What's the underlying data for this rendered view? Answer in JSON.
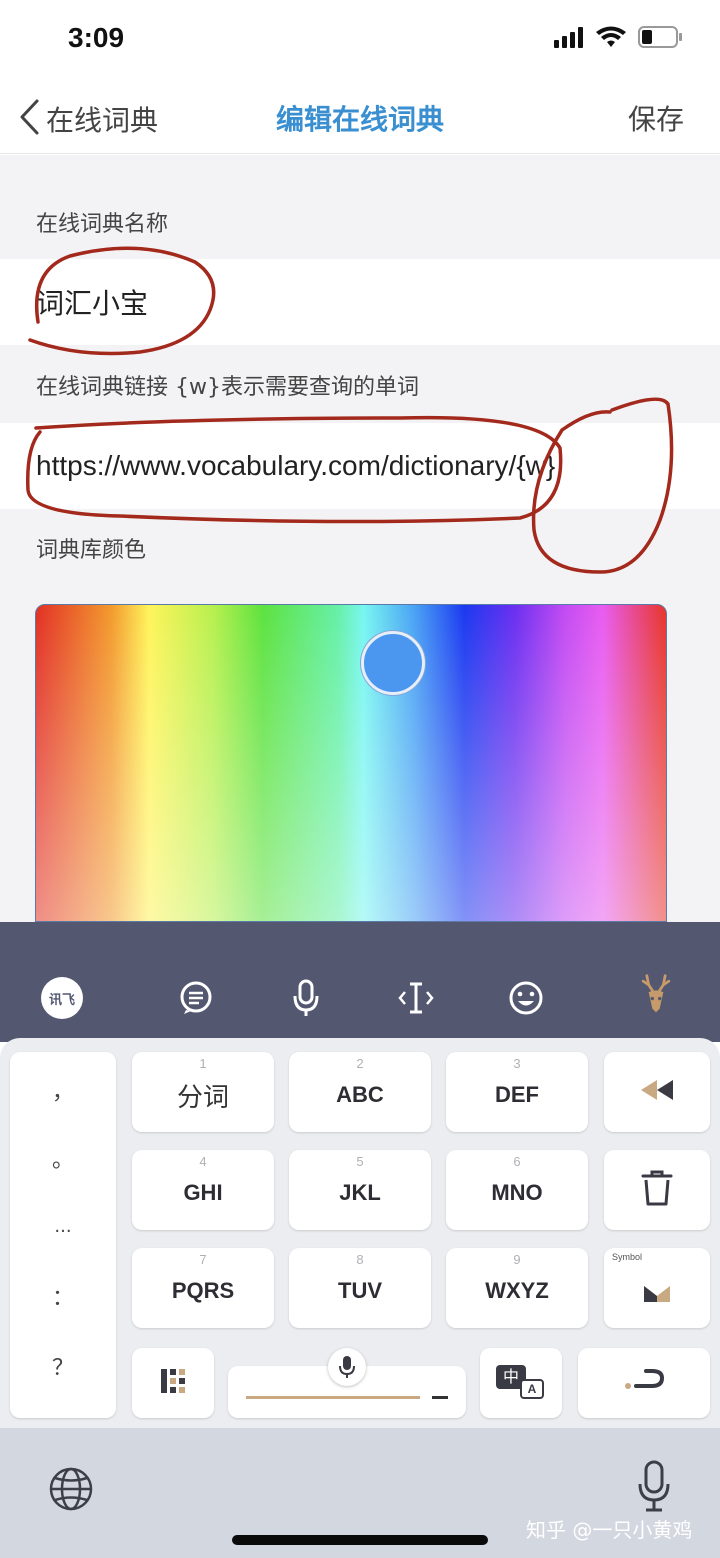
{
  "status_bar": {
    "time": "3:09",
    "icons": [
      "cellular-signal-icon",
      "wifi-icon",
      "battery-icon"
    ]
  },
  "nav": {
    "back_label": "在线词典",
    "title": "编辑在线词典",
    "save_label": "保存",
    "title_color": "#3a8fd1"
  },
  "form": {
    "name_label": "在线词典名称",
    "name_value": "词汇小宝",
    "url_label": "在线词典链接 {w}表示需要查询的单词",
    "url_value": "https://www.vocabulary.com/dictionary/{w}",
    "color_label": "词典库颜色",
    "selected_color": "#4b97f0"
  },
  "annotation_color": "#a3291c",
  "keyboard": {
    "toolbar_icons": [
      "ifly-logo-icon",
      "chat-bubble-icon",
      "microphone-icon",
      "text-cursor-icon",
      "emoji-icon",
      "deer-antler-icon"
    ],
    "ifly_logo_text": "讯飞",
    "punctuation": [
      "，",
      "。",
      "...",
      "：",
      "？"
    ],
    "keys": [
      {
        "num": "1",
        "label": "分词"
      },
      {
        "num": "2",
        "label": "ABC"
      },
      {
        "num": "3",
        "label": "DEF"
      },
      {
        "num": "4",
        "label": "GHI"
      },
      {
        "num": "5",
        "label": "JKL"
      },
      {
        "num": "6",
        "label": "MNO"
      },
      {
        "num": "7",
        "label": "PQRS"
      },
      {
        "num": "8",
        "label": "TUV"
      },
      {
        "num": "9",
        "label": "WXYZ"
      }
    ],
    "symbol_label": "Symbol",
    "lang_switch_cn": "中",
    "lang_switch_en": "A",
    "right_icons": [
      "rewind-icon",
      "trash-icon",
      "symbol-icon",
      "return-icon"
    ]
  },
  "bottom_bar": {
    "icons": [
      "globe-icon",
      "dictation-mic-icon"
    ]
  },
  "watermark": "知乎 @一只小黄鸡"
}
